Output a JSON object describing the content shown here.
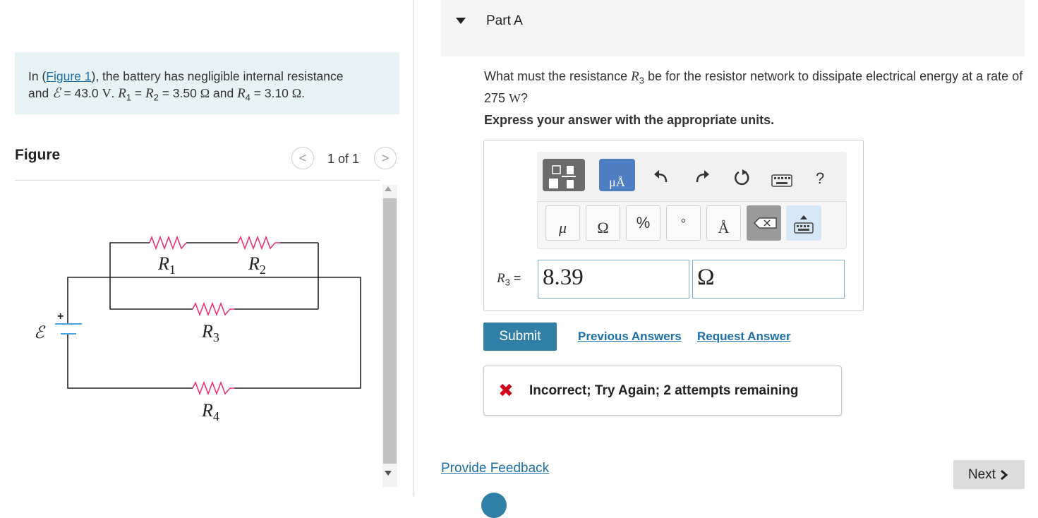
{
  "problem": {
    "intro_prefix": "In (",
    "figure_link": "Figure 1",
    "intro_suffix": "), the battery has negligible internal resistance",
    "line2_and": "and",
    "emf_symbol": "ℰ",
    "emf_value": " = 43.0 ",
    "emf_unit": "V",
    "r1": "R",
    "r1_sub": "1",
    "eq1": " = ",
    "r2": "R",
    "r2_sub": "2",
    "r12_value": " = 3.50 ",
    "ohm": "Ω",
    "and_text": " and ",
    "r4": "R",
    "r4_sub": "4",
    "r4_value": " = 3.10 ",
    "period": "."
  },
  "figure": {
    "title": "Figure",
    "pager": "1 of 1",
    "prev_icon": "<",
    "next_icon": ">",
    "labels": {
      "r1": "R",
      "r1_sub": "1",
      "r2": "R",
      "r2_sub": "2",
      "r3": "R",
      "r3_sub": "3",
      "r4": "R",
      "r4_sub": "4",
      "emf": "ℰ",
      "plus": "+"
    },
    "colors": {
      "wire": "#222222",
      "resistor": "#e8336f",
      "battery": "#4aa3df"
    }
  },
  "part": {
    "title": "Part A",
    "question_prefix": "What must the resistance ",
    "question_r": "R",
    "question_r_sub": "3",
    "question_mid": " be for the resistor network to dissipate electrical energy at a rate of 275 ",
    "question_unit": "W",
    "question_suffix": "?",
    "instruction": "Express your answer with the appropriate units."
  },
  "toolbar": {
    "units_button_label": "μÅ",
    "undo_icon": "undo-icon",
    "redo_icon": "redo-icon",
    "reset_icon": "reset-icon",
    "keyboard_icon": "keyboard-icon",
    "help": "?",
    "mu": "μ",
    "omega": "Ω",
    "percent": "%",
    "degree": "°",
    "angstrom": "Å"
  },
  "answer": {
    "label_r": "R",
    "label_sub": "3",
    "label_eq": " =",
    "value": "8.39",
    "units": "Ω"
  },
  "actions": {
    "submit": "Submit",
    "previous_answers": "Previous Answers",
    "request_answer": "Request Answer"
  },
  "feedback": {
    "icon": "✖",
    "message": "Incorrect; Try Again; 2 attempts remaining"
  },
  "footer": {
    "provide_feedback": "Provide Feedback",
    "next": "Next"
  },
  "colors": {
    "accent": "#2f7fa7",
    "link": "#1a6fa8",
    "error": "#d0021b",
    "problem_bg": "#e6f2f4"
  }
}
